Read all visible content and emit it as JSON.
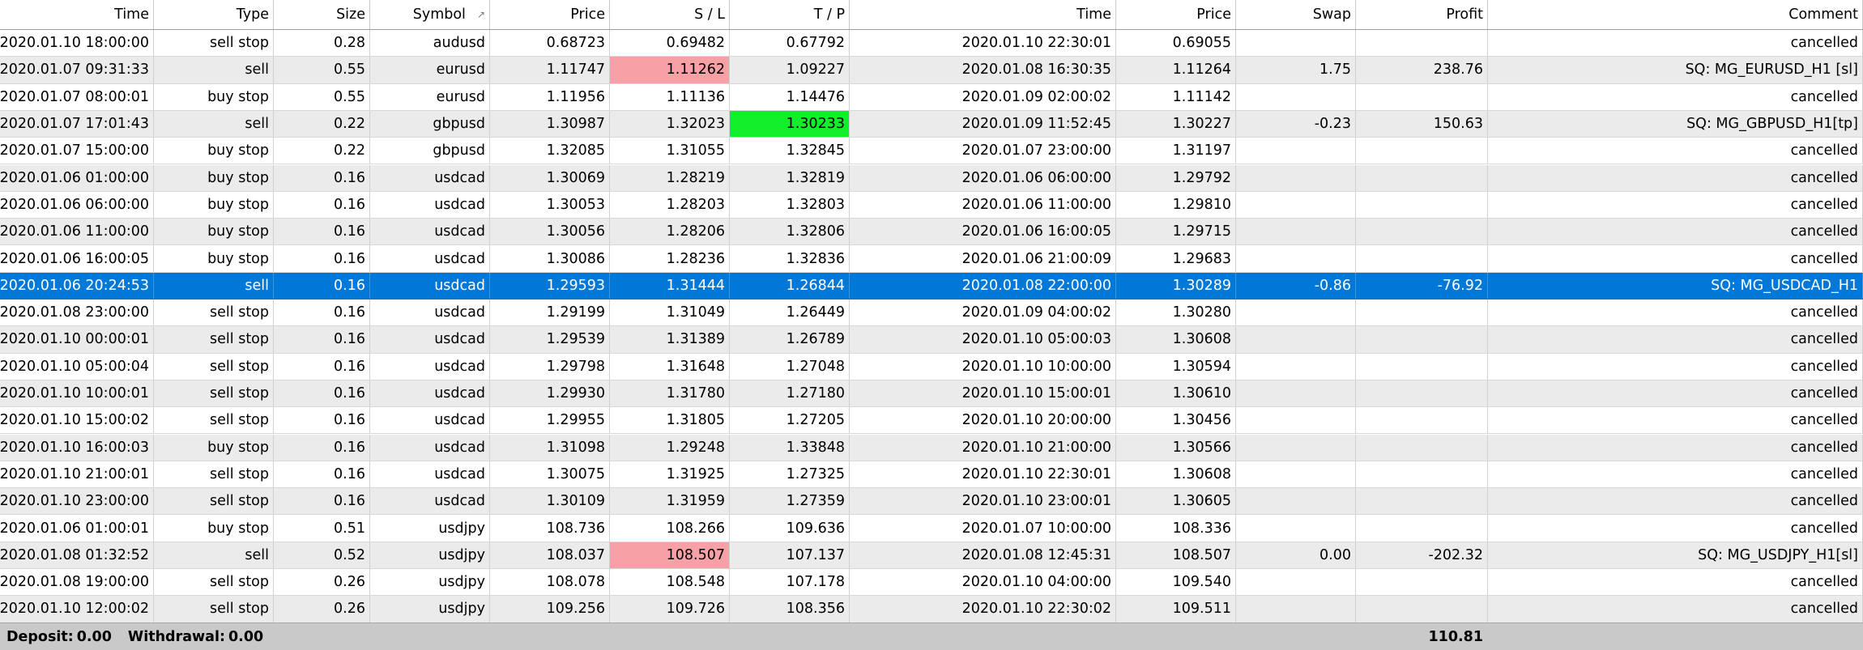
{
  "columns": [
    {
      "key": "open_time",
      "label": "Time"
    },
    {
      "key": "type",
      "label": "Type"
    },
    {
      "key": "size",
      "label": "Size"
    },
    {
      "key": "symbol",
      "label": "Symbol",
      "sort_icon": "↗"
    },
    {
      "key": "open_price",
      "label": "Price"
    },
    {
      "key": "sl",
      "label": "S / L"
    },
    {
      "key": "tp",
      "label": "T / P"
    },
    {
      "key": "close_time",
      "label": "Time"
    },
    {
      "key": "close_price",
      "label": "Price"
    },
    {
      "key": "swap",
      "label": "Swap"
    },
    {
      "key": "profit",
      "label": "Profit"
    },
    {
      "key": "comment",
      "label": "Comment"
    }
  ],
  "rows": [
    {
      "open_time": "2020.01.10 18:00:00",
      "type": "sell stop",
      "size": "0.28",
      "symbol": "audusd",
      "open_price": "0.68723",
      "sl": "0.69482",
      "tp": "0.67792",
      "close_time": "2020.01.10 22:30:01",
      "close_price": "0.69055",
      "swap": "",
      "profit": "",
      "comment": "cancelled"
    },
    {
      "open_time": "2020.01.07 09:31:33",
      "type": "sell",
      "size": "0.55",
      "symbol": "eurusd",
      "open_price": "1.11747",
      "sl": "1.11262",
      "tp": "1.09227",
      "close_time": "2020.01.08 16:30:35",
      "close_price": "1.11264",
      "swap": "1.75",
      "profit": "238.76",
      "comment": "SQ: MG_EURUSD_H1 [sl]",
      "hit": "sl"
    },
    {
      "open_time": "2020.01.07 08:00:01",
      "type": "buy stop",
      "size": "0.55",
      "symbol": "eurusd",
      "open_price": "1.11956",
      "sl": "1.11136",
      "tp": "1.14476",
      "close_time": "2020.01.09 02:00:02",
      "close_price": "1.11142",
      "swap": "",
      "profit": "",
      "comment": "cancelled"
    },
    {
      "open_time": "2020.01.07 17:01:43",
      "type": "sell",
      "size": "0.22",
      "symbol": "gbpusd",
      "open_price": "1.30987",
      "sl": "1.32023",
      "tp": "1.30233",
      "close_time": "2020.01.09 11:52:45",
      "close_price": "1.30227",
      "swap": "-0.23",
      "profit": "150.63",
      "comment": "SQ: MG_GBPUSD_H1[tp]",
      "hit": "tp"
    },
    {
      "open_time": "2020.01.07 15:00:00",
      "type": "buy stop",
      "size": "0.22",
      "symbol": "gbpusd",
      "open_price": "1.32085",
      "sl": "1.31055",
      "tp": "1.32845",
      "close_time": "2020.01.07 23:00:00",
      "close_price": "1.31197",
      "swap": "",
      "profit": "",
      "comment": "cancelled"
    },
    {
      "open_time": "2020.01.06 01:00:00",
      "type": "buy stop",
      "size": "0.16",
      "symbol": "usdcad",
      "open_price": "1.30069",
      "sl": "1.28219",
      "tp": "1.32819",
      "close_time": "2020.01.06 06:00:00",
      "close_price": "1.29792",
      "swap": "",
      "profit": "",
      "comment": "cancelled"
    },
    {
      "open_time": "2020.01.06 06:00:00",
      "type": "buy stop",
      "size": "0.16",
      "symbol": "usdcad",
      "open_price": "1.30053",
      "sl": "1.28203",
      "tp": "1.32803",
      "close_time": "2020.01.06 11:00:00",
      "close_price": "1.29810",
      "swap": "",
      "profit": "",
      "comment": "cancelled"
    },
    {
      "open_time": "2020.01.06 11:00:00",
      "type": "buy stop",
      "size": "0.16",
      "symbol": "usdcad",
      "open_price": "1.30056",
      "sl": "1.28206",
      "tp": "1.32806",
      "close_time": "2020.01.06 16:00:05",
      "close_price": "1.29715",
      "swap": "",
      "profit": "",
      "comment": "cancelled"
    },
    {
      "open_time": "2020.01.06 16:00:05",
      "type": "buy stop",
      "size": "0.16",
      "symbol": "usdcad",
      "open_price": "1.30086",
      "sl": "1.28236",
      "tp": "1.32836",
      "close_time": "2020.01.06 21:00:09",
      "close_price": "1.29683",
      "swap": "",
      "profit": "",
      "comment": "cancelled"
    },
    {
      "open_time": "2020.01.06 20:24:53",
      "type": "sell",
      "size": "0.16",
      "symbol": "usdcad",
      "open_price": "1.29593",
      "sl": "1.31444",
      "tp": "1.26844",
      "close_time": "2020.01.08 22:00:00",
      "close_price": "1.30289",
      "swap": "-0.86",
      "profit": "-76.92",
      "comment": "SQ: MG_USDCAD_H1",
      "selected": true
    },
    {
      "open_time": "2020.01.08 23:00:00",
      "type": "sell stop",
      "size": "0.16",
      "symbol": "usdcad",
      "open_price": "1.29199",
      "sl": "1.31049",
      "tp": "1.26449",
      "close_time": "2020.01.09 04:00:02",
      "close_price": "1.30280",
      "swap": "",
      "profit": "",
      "comment": "cancelled"
    },
    {
      "open_time": "2020.01.10 00:00:01",
      "type": "sell stop",
      "size": "0.16",
      "symbol": "usdcad",
      "open_price": "1.29539",
      "sl": "1.31389",
      "tp": "1.26789",
      "close_time": "2020.01.10 05:00:03",
      "close_price": "1.30608",
      "swap": "",
      "profit": "",
      "comment": "cancelled"
    },
    {
      "open_time": "2020.01.10 05:00:04",
      "type": "sell stop",
      "size": "0.16",
      "symbol": "usdcad",
      "open_price": "1.29798",
      "sl": "1.31648",
      "tp": "1.27048",
      "close_time": "2020.01.10 10:00:00",
      "close_price": "1.30594",
      "swap": "",
      "profit": "",
      "comment": "cancelled"
    },
    {
      "open_time": "2020.01.10 10:00:01",
      "type": "sell stop",
      "size": "0.16",
      "symbol": "usdcad",
      "open_price": "1.29930",
      "sl": "1.31780",
      "tp": "1.27180",
      "close_time": "2020.01.10 15:00:01",
      "close_price": "1.30610",
      "swap": "",
      "profit": "",
      "comment": "cancelled"
    },
    {
      "open_time": "2020.01.10 15:00:02",
      "type": "sell stop",
      "size": "0.16",
      "symbol": "usdcad",
      "open_price": "1.29955",
      "sl": "1.31805",
      "tp": "1.27205",
      "close_time": "2020.01.10 20:00:00",
      "close_price": "1.30456",
      "swap": "",
      "profit": "",
      "comment": "cancelled"
    },
    {
      "open_time": "2020.01.10 16:00:03",
      "type": "buy stop",
      "size": "0.16",
      "symbol": "usdcad",
      "open_price": "1.31098",
      "sl": "1.29248",
      "tp": "1.33848",
      "close_time": "2020.01.10 21:00:00",
      "close_price": "1.30566",
      "swap": "",
      "profit": "",
      "comment": "cancelled"
    },
    {
      "open_time": "2020.01.10 21:00:01",
      "type": "sell stop",
      "size": "0.16",
      "symbol": "usdcad",
      "open_price": "1.30075",
      "sl": "1.31925",
      "tp": "1.27325",
      "close_time": "2020.01.10 22:30:01",
      "close_price": "1.30608",
      "swap": "",
      "profit": "",
      "comment": "cancelled"
    },
    {
      "open_time": "2020.01.10 23:00:00",
      "type": "sell stop",
      "size": "0.16",
      "symbol": "usdcad",
      "open_price": "1.30109",
      "sl": "1.31959",
      "tp": "1.27359",
      "close_time": "2020.01.10 23:00:01",
      "close_price": "1.30605",
      "swap": "",
      "profit": "",
      "comment": "cancelled"
    },
    {
      "open_time": "2020.01.06 01:00:01",
      "type": "buy stop",
      "size": "0.51",
      "symbol": "usdjpy",
      "open_price": "108.736",
      "sl": "108.266",
      "tp": "109.636",
      "close_time": "2020.01.07 10:00:00",
      "close_price": "108.336",
      "swap": "",
      "profit": "",
      "comment": "cancelled"
    },
    {
      "open_time": "2020.01.08 01:32:52",
      "type": "sell",
      "size": "0.52",
      "symbol": "usdjpy",
      "open_price": "108.037",
      "sl": "108.507",
      "tp": "107.137",
      "close_time": "2020.01.08 12:45:31",
      "close_price": "108.507",
      "swap": "0.00",
      "profit": "-202.32",
      "comment": "SQ: MG_USDJPY_H1[sl]",
      "hit": "sl"
    },
    {
      "open_time": "2020.01.08 19:00:00",
      "type": "sell stop",
      "size": "0.26",
      "symbol": "usdjpy",
      "open_price": "108.078",
      "sl": "108.548",
      "tp": "107.178",
      "close_time": "2020.01.10 04:00:00",
      "close_price": "109.540",
      "swap": "",
      "profit": "",
      "comment": "cancelled"
    },
    {
      "open_time": "2020.01.10 12:00:02",
      "type": "sell stop",
      "size": "0.26",
      "symbol": "usdjpy",
      "open_price": "109.256",
      "sl": "109.726",
      "tp": "108.356",
      "close_time": "2020.01.10 22:30:02",
      "close_price": "109.511",
      "swap": "",
      "profit": "",
      "comment": "cancelled"
    }
  ],
  "footer": {
    "deposit_label": "Deposit:",
    "deposit_value": "0.00",
    "withdrawal_label": "Withdrawal:",
    "withdrawal_value": "0.00",
    "total_profit": "110.81"
  },
  "colors": {
    "selected_row": "#0078d7",
    "sl_hit": "#f7a1a7",
    "tp_hit": "#13ee2a",
    "alt_row": "#ebebeb",
    "footer": "#c9c9c9"
  }
}
